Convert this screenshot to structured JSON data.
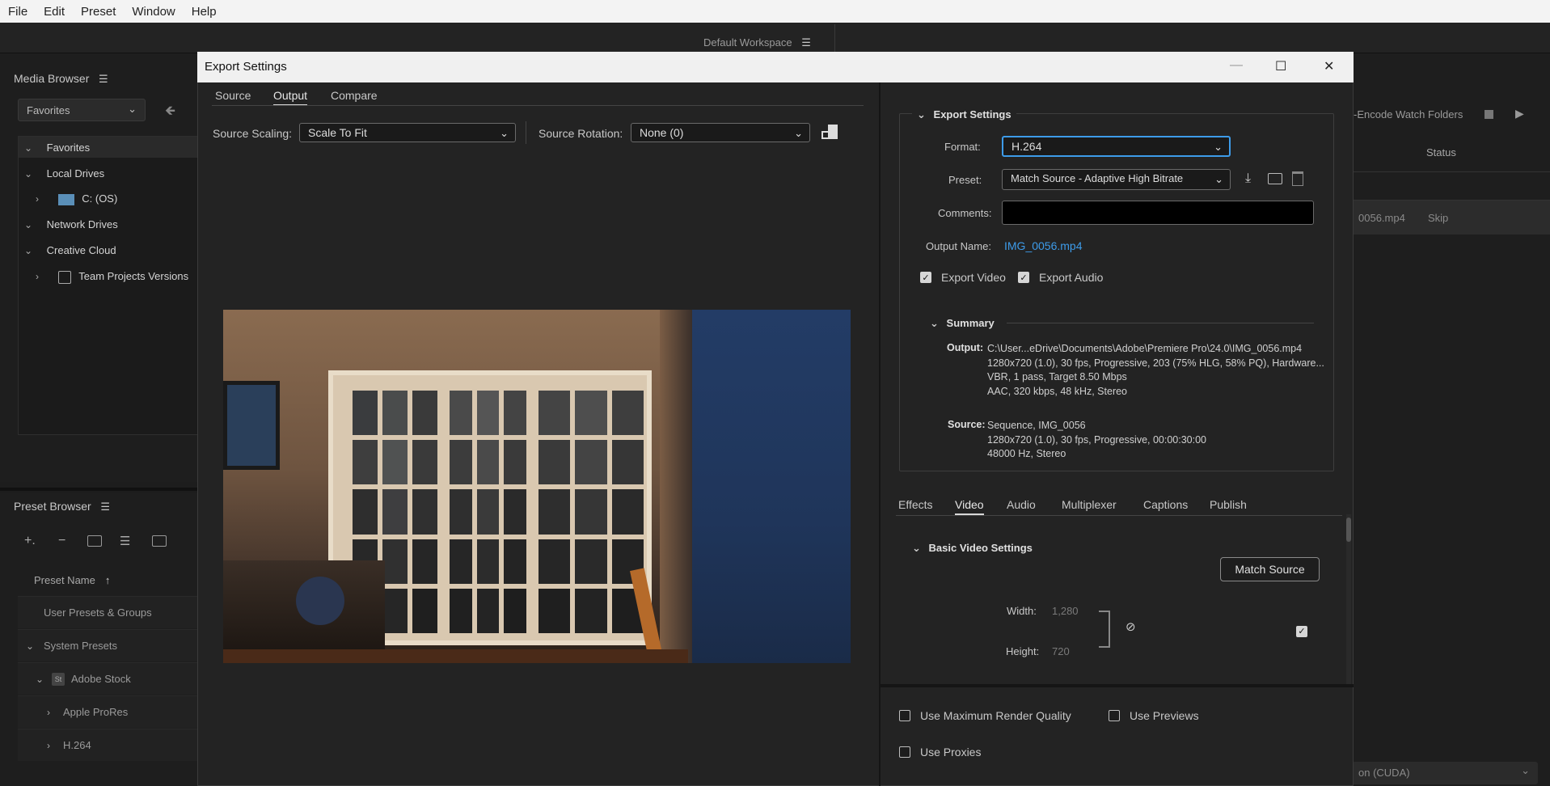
{
  "menu": [
    "File",
    "Edit",
    "Preset",
    "Window",
    "Help"
  ],
  "workspace": {
    "label": "Default Workspace"
  },
  "media_browser": {
    "title": "Media Browser",
    "dropdown": "Favorites",
    "tree": [
      {
        "label": "Favorites"
      },
      {
        "label": "Local Drives"
      },
      {
        "label": "C: (OS)"
      },
      {
        "label": "Network Drives"
      },
      {
        "label": "Creative Cloud"
      },
      {
        "label": "Team Projects Versions"
      }
    ]
  },
  "preset_browser": {
    "title": "Preset Browser",
    "column": "Preset Name",
    "rows": [
      "User Presets & Groups",
      "System Presets",
      "Adobe Stock",
      "Apple ProRes",
      "H.264"
    ]
  },
  "queue": {
    "watch_folders": "-Encode Watch Folders",
    "status_header": "Status",
    "item_name": "0056.mp4",
    "item_status": "Skip",
    "renderer": "on (CUDA)"
  },
  "dialog": {
    "title": "Export Settings",
    "tabs": [
      "Source",
      "Output",
      "Compare"
    ],
    "source_scaling_label": "Source Scaling:",
    "source_scaling_value": "Scale To Fit",
    "source_rotation_label": "Source Rotation:",
    "source_rotation_value": "None (0)"
  },
  "export_settings": {
    "section": "Export Settings",
    "format_label": "Format:",
    "format_value": "H.264",
    "preset_label": "Preset:",
    "preset_value": "Match Source - Adaptive High Bitrate",
    "comments_label": "Comments:",
    "comments_value": "",
    "output_name_label": "Output Name:",
    "output_name_value": "IMG_0056.mp4",
    "export_video": "Export Video",
    "export_audio": "Export Audio"
  },
  "summary": {
    "title": "Summary",
    "output_key": "Output:",
    "output_lines": [
      "C:\\User...eDrive\\Documents\\Adobe\\Premiere Pro\\24.0\\IMG_0056.mp4",
      "1280x720 (1.0), 30 fps, Progressive, 203 (75% HLG, 58% PQ), Hardware...",
      "VBR, 1 pass, Target 8.50 Mbps",
      "AAC, 320 kbps, 48 kHz, Stereo"
    ],
    "source_key": "Source:",
    "source_lines": [
      "Sequence, IMG_0056",
      "1280x720 (1.0), 30 fps, Progressive, 00:00:30:00",
      "48000 Hz, Stereo"
    ]
  },
  "settings_tabs": [
    "Effects",
    "Video",
    "Audio",
    "Multiplexer",
    "Captions",
    "Publish"
  ],
  "basic_video": {
    "title": "Basic Video Settings",
    "match_source": "Match Source",
    "width_label": "Width:",
    "width_value": "1,280",
    "height_label": "Height:",
    "height_value": "720"
  },
  "bottom_options": {
    "max_render": "Use Maximum Render Quality",
    "use_previews": "Use Previews",
    "use_proxies": "Use Proxies"
  },
  "colors": {
    "accent": "#3d9be9",
    "dialog_bg": "#232323"
  }
}
